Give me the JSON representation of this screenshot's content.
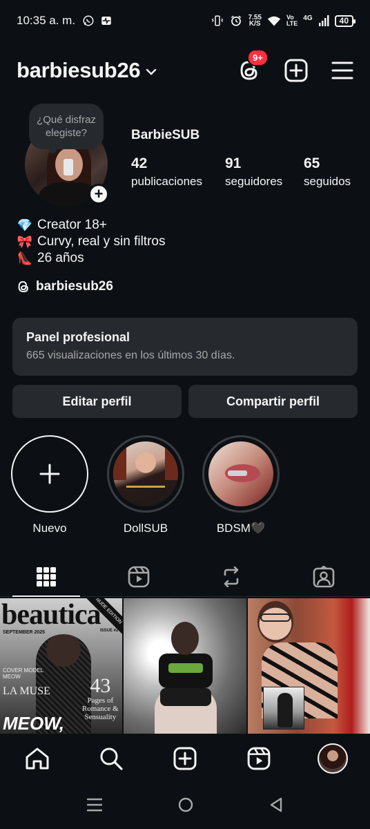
{
  "status_bar": {
    "time": "10:35 a. m.",
    "speed_value": "7.55",
    "speed_unit": "K/S",
    "volte_top": "Vo",
    "volte_bottom": "LTE",
    "network": "4G",
    "battery": "40"
  },
  "header": {
    "username": "barbiesub26",
    "notification_count": "9+"
  },
  "profile": {
    "note": "¿Qué disfraz elegiste?",
    "display_name": "BarbieSUB",
    "stats": [
      {
        "value": "42",
        "label": "publicaciones"
      },
      {
        "value": "91",
        "label": "seguidores"
      },
      {
        "value": "65",
        "label": "seguidos"
      }
    ],
    "bio": [
      {
        "emoji": "💎",
        "text": "Creator 18+"
      },
      {
        "emoji": "🎀",
        "text": "Curvy, real y sin filtros"
      },
      {
        "emoji": "👠",
        "text": "26 años"
      }
    ],
    "threads_handle": "barbiesub26"
  },
  "panel": {
    "title": "Panel profesional",
    "subtitle": "665 visualizaciones en los últimos 30 días."
  },
  "buttons": {
    "edit": "Editar perfil",
    "share": "Compartir perfil"
  },
  "highlights": [
    {
      "label": "Nuevo"
    },
    {
      "label": "DollSUB"
    },
    {
      "label": "BDSM🖤"
    }
  ],
  "grid": {
    "post1": {
      "title": "beautica",
      "month": "SEPTEMBER 2025",
      "issue": "ISSUE #2",
      "cover_line1": "COVER MODEL",
      "cover_line2": "MEOW",
      "muse": "LA MUSE",
      "pages_num": "43",
      "pages_text": "Pages of Romance & Sensuality",
      "headline": "MEOW,",
      "sash": "NUDE EDITION"
    }
  },
  "colors": {
    "background": "#0c1014",
    "surface": "#262a2f",
    "badge": "#ff3040",
    "text": "#f5f5f5",
    "muted": "#a8a8a8"
  }
}
